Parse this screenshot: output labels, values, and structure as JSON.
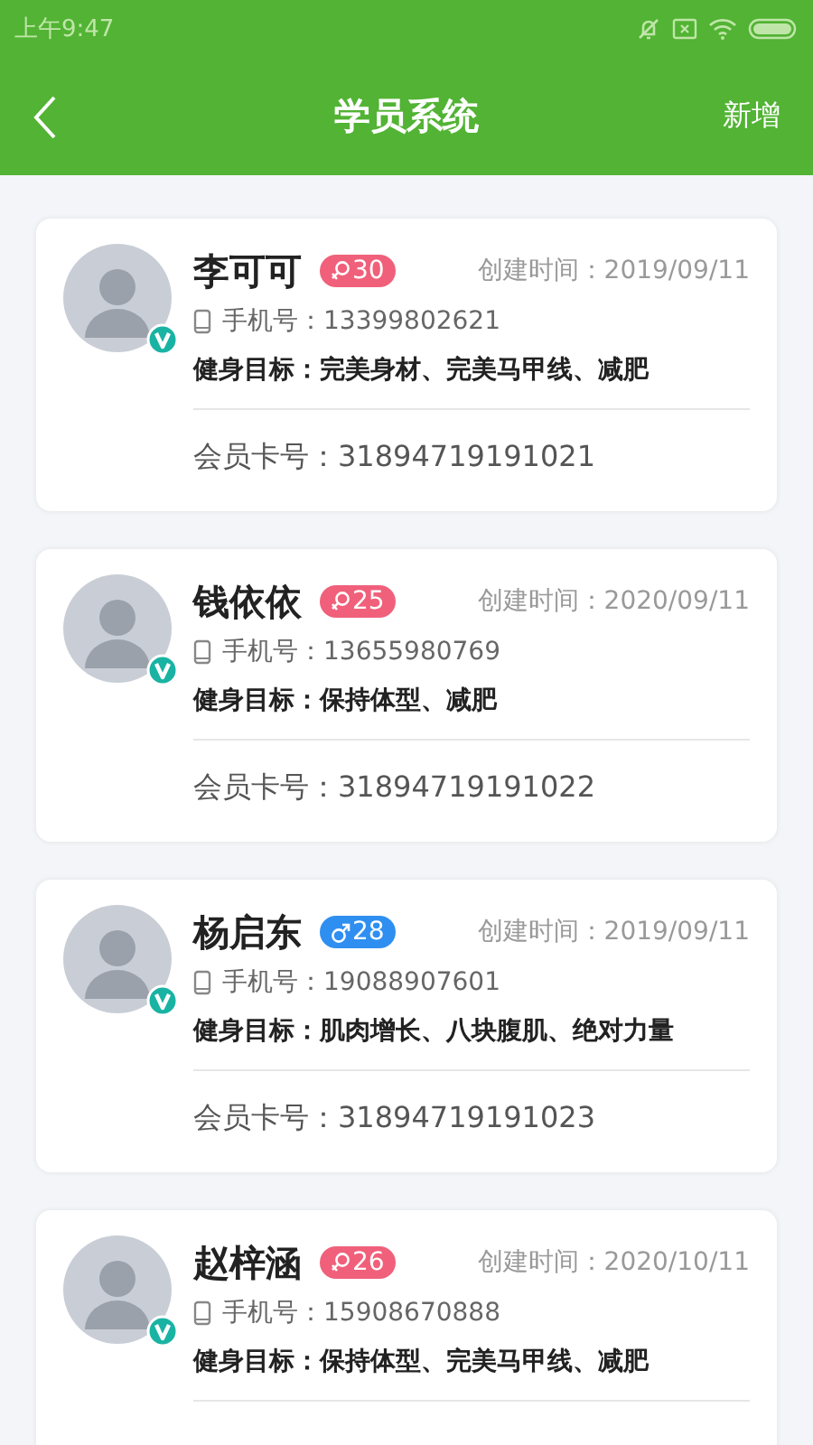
{
  "status_bar": {
    "time": "上午9:47"
  },
  "header": {
    "title": "学员系统",
    "action": "新增"
  },
  "members": [
    {
      "name": "李可可",
      "kind": "female",
      "age": "30",
      "created": "创建时间：2019/09/11",
      "phone": "手机号：13399802621",
      "goal_label": "健身目标：",
      "goals": "完美身材、完美马甲线、减肥",
      "card_no": "会员卡号：31894719191021",
      "verified": true
    },
    {
      "name": "钱依依",
      "kind": "female",
      "age": "25",
      "created": "创建时间：2020/09/11",
      "phone": "手机号：13655980769",
      "goal_label": "健身目标：",
      "goals": "保持体型、减肥",
      "card_no": "会员卡号：31894719191022",
      "verified": true
    },
    {
      "name": "杨启东",
      "kind": "male",
      "age": "28",
      "created": "创建时间：2019/09/11",
      "phone": "手机号：19088907601",
      "goal_label": "健身目标：",
      "goals": "肌肉增长、八块腹肌、绝对力量",
      "card_no": "会员卡号：31894719191023",
      "verified": true
    },
    {
      "name": "赵梓涵",
      "kind": "female",
      "age": "26",
      "created": "创建时间：2020/10/11",
      "phone": "手机号：15908670888",
      "goal_label": "健身目标：",
      "goals": "保持体型、完美马甲线、减肥",
      "verified": true
    }
  ]
}
